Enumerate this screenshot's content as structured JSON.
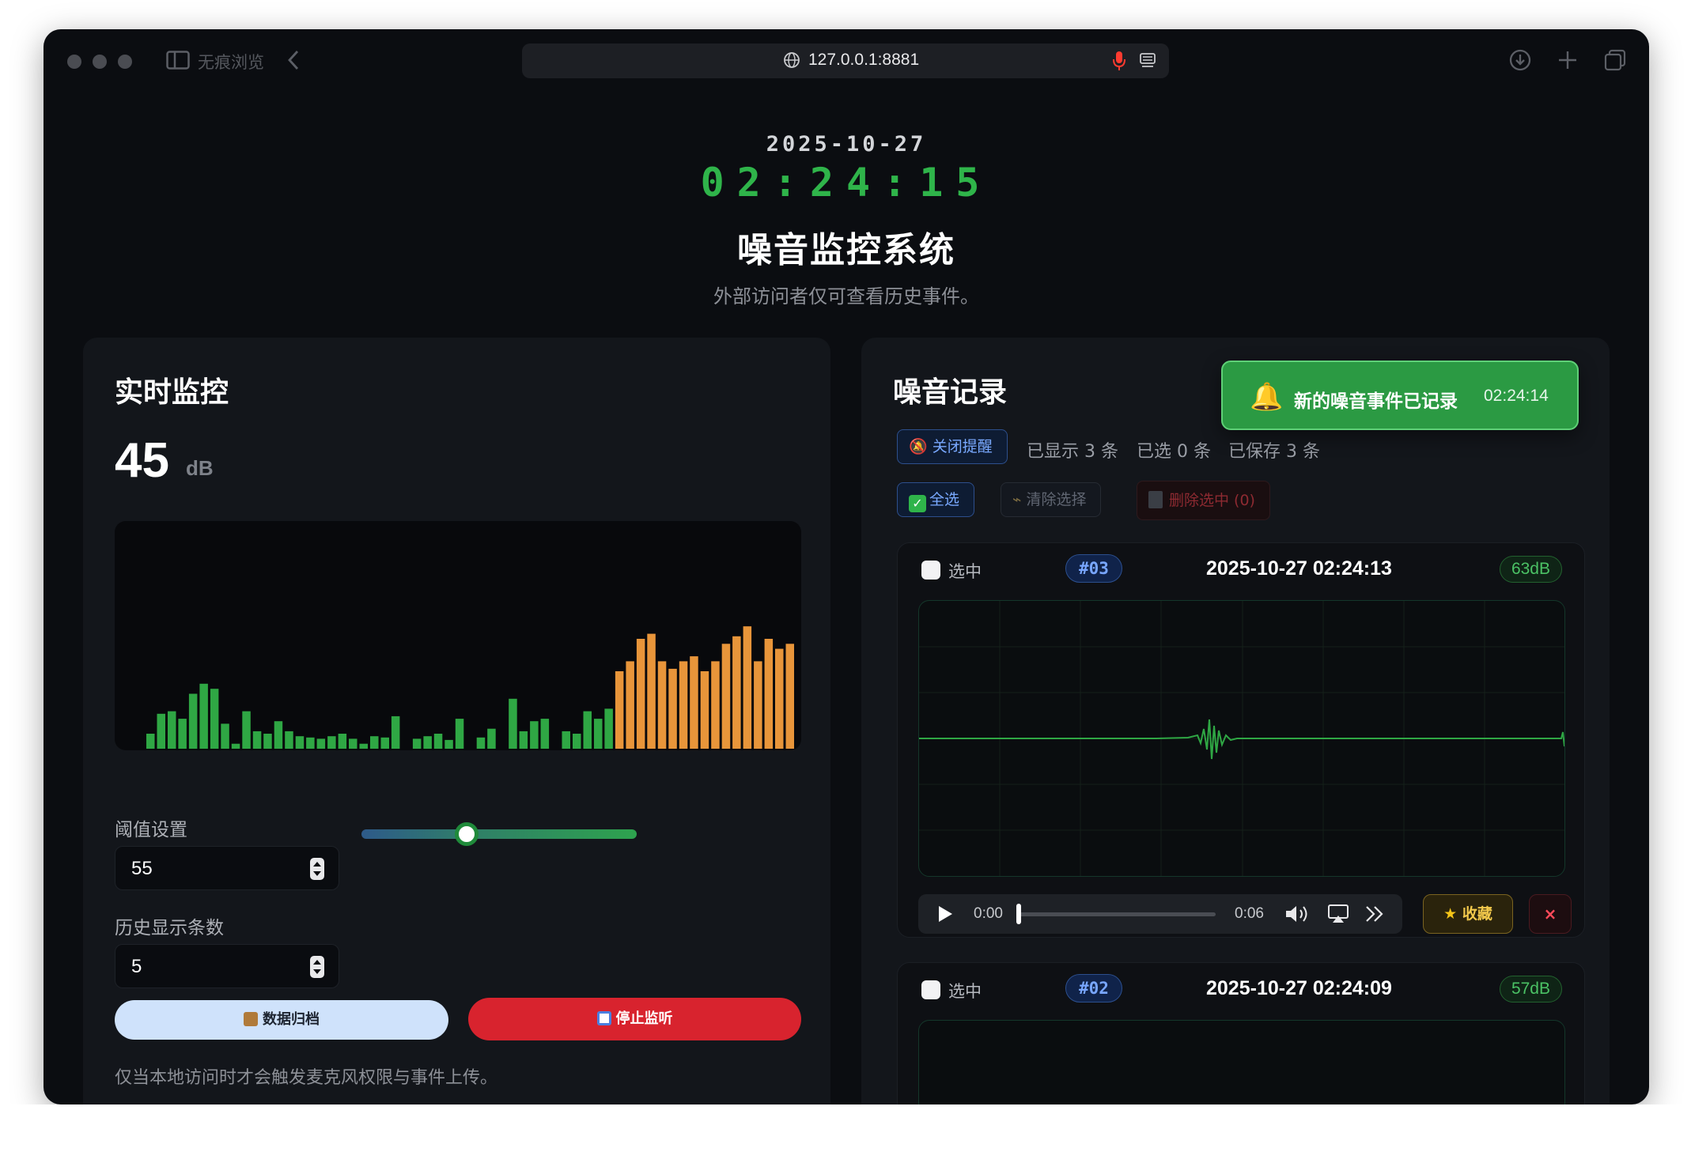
{
  "browser": {
    "private_label": "无痕浏览",
    "url": "127.0.0.1:8881"
  },
  "header": {
    "date": "2025-10-27",
    "time": "02:24:15",
    "title": "噪音监控系统",
    "subtitle": "外部访问者仅可查看历史事件。"
  },
  "monitor": {
    "title": "实时监控",
    "level_value": "45",
    "level_unit": "dB",
    "history_bars": {
      "max": 100,
      "threshold": 55,
      "values": [
        12,
        28,
        30,
        24,
        44,
        52,
        48,
        20,
        4,
        30,
        14,
        12,
        22,
        14,
        10,
        9,
        8,
        10,
        12,
        8,
        4,
        10,
        9,
        26,
        0,
        8,
        10,
        12,
        7,
        24,
        0,
        9,
        16,
        0,
        40,
        14,
        22,
        24,
        0,
        14,
        12,
        30,
        24,
        32,
        62,
        70,
        88,
        92,
        70,
        64,
        70,
        74,
        62,
        70,
        84,
        90,
        98,
        70,
        88,
        80,
        84
      ],
      "colors": {
        "below": "#2fa744",
        "above": "#e8953a"
      }
    },
    "threshold_label": "阈值设置",
    "threshold_value": "55",
    "threshold_slider": {
      "min": 0,
      "max": 100,
      "value": 37
    },
    "history_count_label": "历史显示条数",
    "history_count_value": "5",
    "archive_button": "数据归档",
    "stop_button": "停止监听",
    "footnote": "仅当本地访问时才会触发麦克风权限与事件上传。"
  },
  "records": {
    "title": "噪音记录",
    "toast": {
      "text": "新的噪音事件已记录",
      "time": "02:24:14"
    },
    "close_alert": "关闭提醒",
    "stats": {
      "shown": "已显示 3 条",
      "selected": "已选 0 条",
      "saved": "已保存 3 条"
    },
    "select_all": "全选",
    "clear_selection": "清除选择",
    "delete_selected": "删除选中 (0)",
    "items": [
      {
        "check_label": "选中",
        "id": "#03",
        "time": "2025-10-27 02:24:13",
        "db": "63dB",
        "audio": {
          "current": "0:00",
          "duration": "0:06"
        },
        "favorite": "收藏",
        "remove": "×"
      },
      {
        "check_label": "选中",
        "id": "#02",
        "time": "2025-10-27 02:24:09",
        "db": "57dB"
      }
    ]
  },
  "colors": {
    "accent_green": "#2fb44a",
    "danger_red": "#d8232e",
    "toast_green": "#2b9a43"
  }
}
